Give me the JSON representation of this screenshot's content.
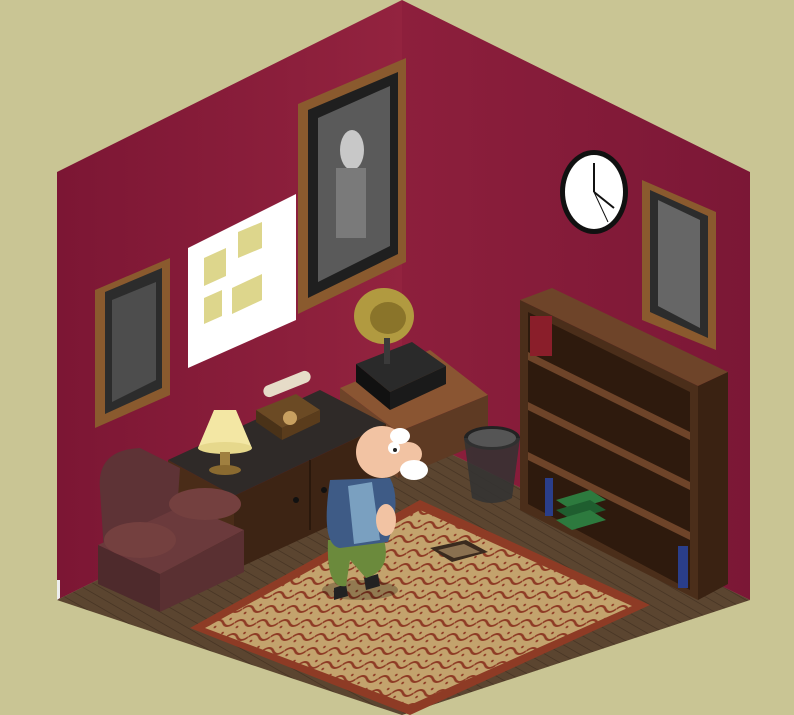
{
  "scene": {
    "description_kind": "isometric room",
    "colors": {
      "background": "#c9c594",
      "wall": "#8a1e3c",
      "wall_dark": "#6e1530",
      "floor": "#5b4630",
      "rug": "#b99863",
      "rug_pattern": "#8e3b25",
      "bookshelf": "#5e3a23",
      "cabinet": "#2f2723",
      "armchair": "#6b3a3c",
      "table": "#7a4a2c",
      "frame": "#8a5a2e",
      "lamp_shade": "#f3e7a4",
      "gramophone_horn": "#a08a3a",
      "character_shirt": "#3e5b86",
      "character_pants": "#6b8a3c",
      "skin": "#f2c3a3",
      "hair": "#ffffff",
      "book_green": "#2d7a3e",
      "book_blue": "#2a3e8a"
    },
    "objects": [
      "painting-left",
      "broken-window",
      "painting-large",
      "wall-clock",
      "painting-right",
      "gramophone",
      "telephone",
      "table-lamp",
      "armchair",
      "side-cabinet",
      "bookshelf",
      "wastebasket",
      "rug",
      "old-man-character",
      "open-box"
    ]
  }
}
